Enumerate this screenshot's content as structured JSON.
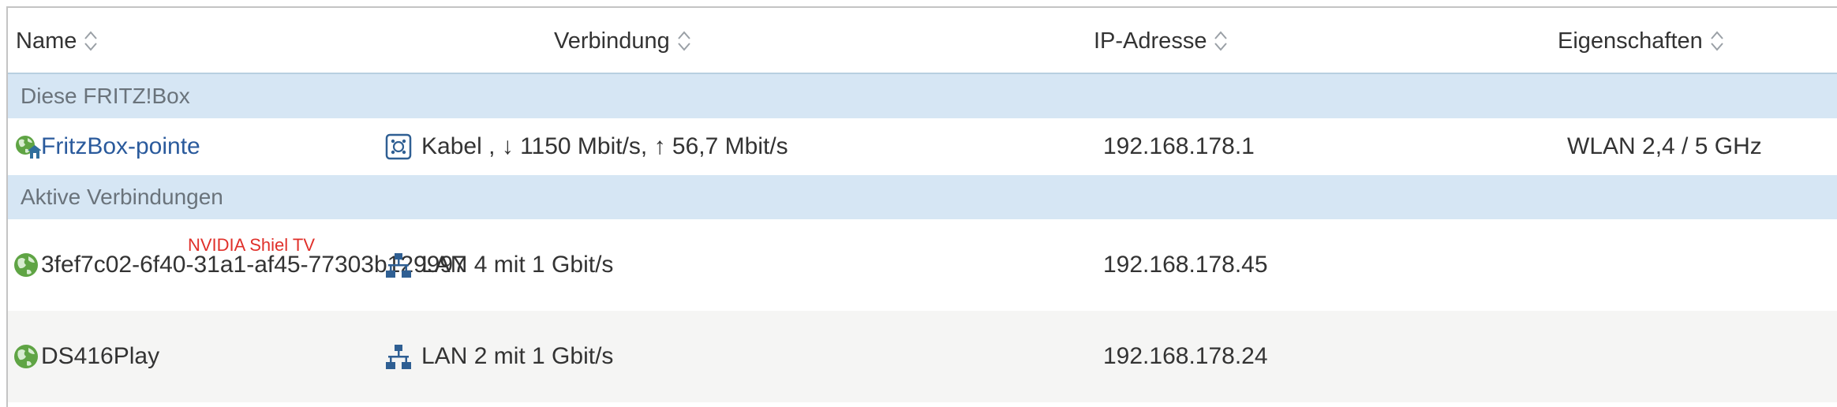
{
  "header": {
    "col_name": "Name",
    "col_connection": "Verbindung",
    "col_ip": "IP-Adresse",
    "col_properties": "Eigenschaften"
  },
  "groups": {
    "this_box": "Diese FRITZ!Box",
    "active": "Aktive Verbindungen"
  },
  "fritzbox": {
    "name": "FritzBox-pointe",
    "connection": "Kabel , ↓ 1150 Mbit/s, ↑ 56,7 Mbit/s",
    "ip": "192.168.178.1",
    "properties": "WLAN 2,4 / 5 GHz"
  },
  "devices": [
    {
      "name": "3fef7c02-6f40-31a1-af45-77303b129997",
      "annotation": "NVIDIA Shiel TV",
      "connection": "LAN 4 mit 1 Gbit/s",
      "ip": "192.168.178.45"
    },
    {
      "name": "DS416Play",
      "connection": "LAN 2 mit 1 Gbit/s",
      "ip": "192.168.178.24"
    }
  ],
  "colors": {
    "group_bg": "#d6e6f4",
    "link": "#2a5a9c",
    "globe": "#5fa444",
    "annotation": "#e0302a",
    "alt_row": "#f5f5f4"
  },
  "icons": {
    "sort": "sort-updown-icon",
    "device": "globe-icon",
    "router": "globe-home-icon",
    "cable": "cable-modem-icon",
    "lan": "network-lan-icon"
  }
}
